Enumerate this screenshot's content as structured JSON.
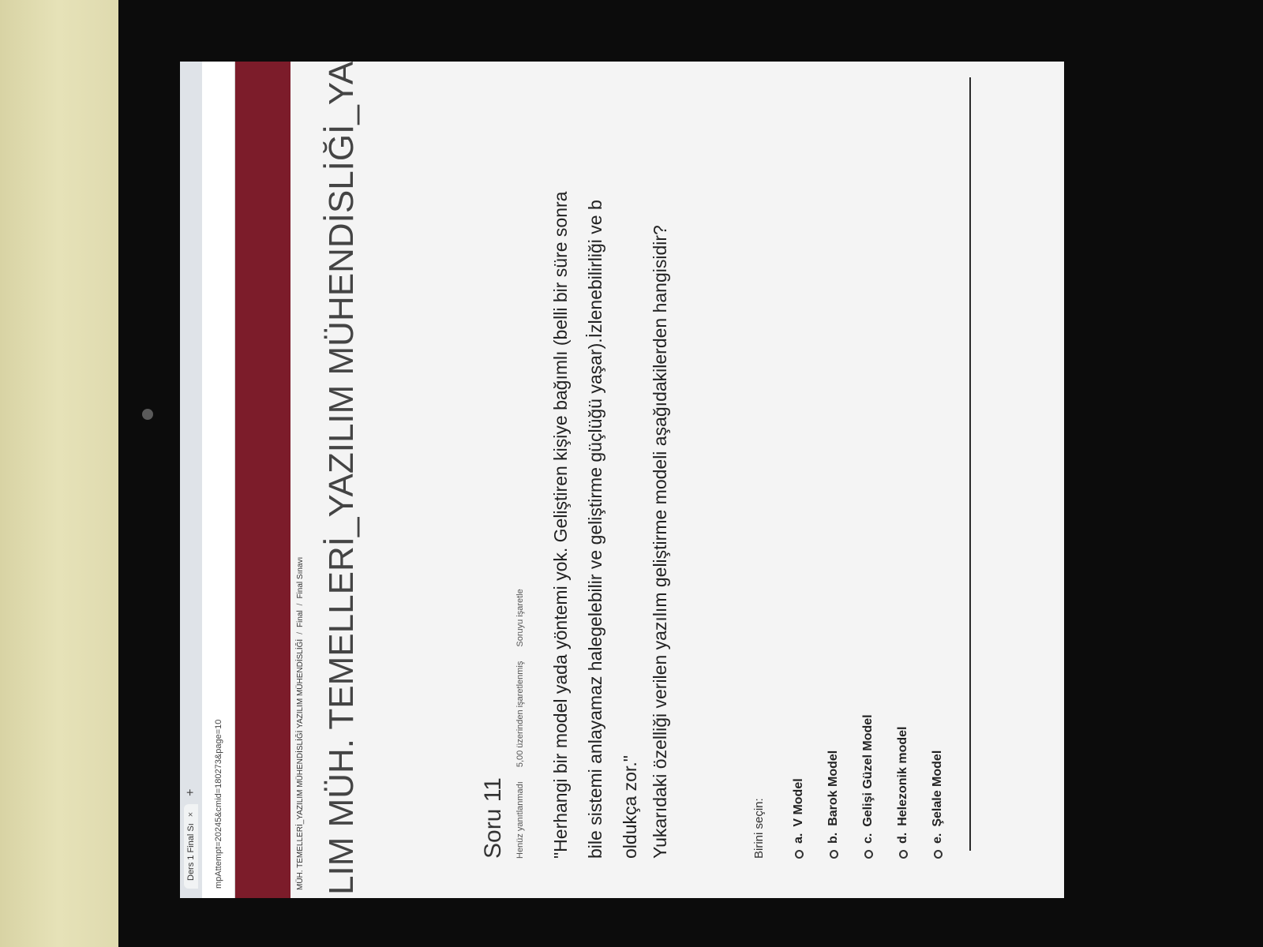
{
  "browser": {
    "tab_title": "Ders 1 Final Sı",
    "tab_close": "×",
    "new_tab": "+",
    "url": "mpAttempt=20245&cmid=180273&page=10"
  },
  "breadcrumb": {
    "items": [
      "MÜH. TEMELLERİ_YAZILIM MÜHENDİSLİĞİ YAZILIM MÜHENDİSLİĞİ",
      "Final",
      "Final Sınavı"
    ],
    "separator": "/"
  },
  "course_title": "LIM MÜH. TEMELLERİ_YAZILIM MÜHENDİSLİĞİ_YA",
  "question": {
    "title": "Soru 11",
    "status": "Henüz yanıtlanmadı",
    "points": "5,00 üzerinden işaretlenmiş",
    "flag": "Soruyu işaretle",
    "text_lines": [
      "\"Herhangi bir model yada yöntemi yok. Geliştiren kişiye bağımlı (belli bir süre sonra",
      "bile sistemi anlayamaz halegelebilir ve geliştirme güçlüğü yaşar).İzlenebilirliği ve b",
      "oldukça zor.\""
    ],
    "prompt": "Yukarıdaki özelliği verilen yazılım geliştirme modeli aşağıdakilerden hangisidir?",
    "choose_label": "Birini seçin:",
    "options": [
      {
        "letter": "a.",
        "label": "V Model"
      },
      {
        "letter": "b.",
        "label": "Barok Model"
      },
      {
        "letter": "c.",
        "label": "Gelişi Güzel Model"
      },
      {
        "letter": "d.",
        "label": "Helezonik model"
      },
      {
        "letter": "e.",
        "label": "Şelale Model"
      }
    ]
  }
}
